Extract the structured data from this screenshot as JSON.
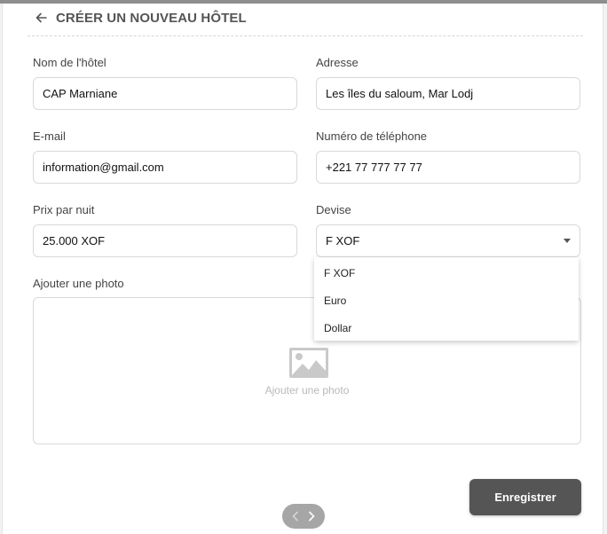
{
  "header": {
    "title": "CRÉER UN NOUVEAU HÔTEL"
  },
  "form": {
    "hotel_name": {
      "label": "Nom de l'hôtel",
      "value": "CAP Marniane"
    },
    "address": {
      "label": "Adresse",
      "value": "Les îles du saloum, Mar Lodj"
    },
    "email": {
      "label": "E-mail",
      "value": "information@gmail.com"
    },
    "phone": {
      "label": "Numéro de téléphone",
      "value": "+221 77 777 77 77"
    },
    "price": {
      "label": "Prix par nuit",
      "value": "25.000 XOF"
    },
    "currency": {
      "label": "Devise",
      "selected": "F XOF",
      "options": [
        "F XOF",
        "Euro",
        "Dollar"
      ]
    },
    "photo": {
      "label": "Ajouter une photo",
      "placeholder": "Ajouter une photo"
    }
  },
  "actions": {
    "save_label": "Enregistrer"
  },
  "icons": {
    "back": "arrow-left-icon",
    "caret": "caret-down-icon",
    "image": "image-icon",
    "prev": "chevron-left-icon",
    "next": "chevron-right-icon"
  }
}
